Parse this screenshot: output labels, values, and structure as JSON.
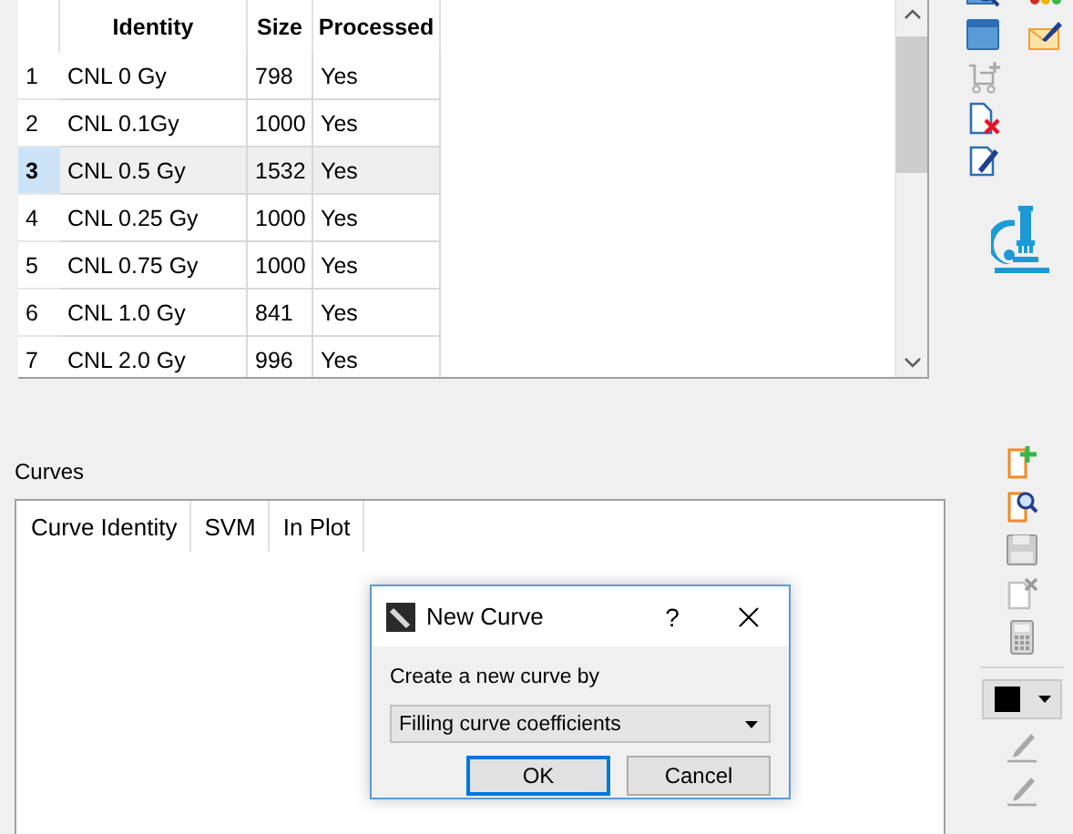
{
  "table": {
    "columns": [
      "Identity",
      "Size",
      "Processed"
    ],
    "rows": [
      {
        "index": "1",
        "cells": [
          "CNL 0 Gy",
          "798",
          "Yes"
        ],
        "selected": false
      },
      {
        "index": "2",
        "cells": [
          "CNL 0.1Gy",
          "1000",
          "Yes"
        ],
        "selected": false
      },
      {
        "index": "3",
        "cells": [
          "CNL 0.5 Gy",
          "1532",
          "Yes"
        ],
        "selected": true
      },
      {
        "index": "4",
        "cells": [
          "CNL 0.25 Gy",
          "1000",
          "Yes"
        ],
        "selected": false
      },
      {
        "index": "5",
        "cells": [
          "CNL 0.75 Gy",
          "1000",
          "Yes"
        ],
        "selected": false
      },
      {
        "index": "6",
        "cells": [
          "CNL 1.0 Gy",
          "841",
          "Yes"
        ],
        "selected": false
      },
      {
        "index": "7",
        "cells": [
          "CNL 2.0 Gy",
          "996",
          "Yes"
        ],
        "selected": false
      }
    ]
  },
  "curves": {
    "label": "Curves",
    "columns": [
      "Curve Identity",
      "SVM",
      "In Plot"
    ]
  },
  "dialog": {
    "title": "New Curve",
    "help": "?",
    "prompt": "Create a new curve by",
    "combo": {
      "value": "Filling curve coefficients"
    },
    "buttons": [
      {
        "label": "OK",
        "default": true
      },
      {
        "label": "Cancel",
        "default": false
      }
    ]
  }
}
